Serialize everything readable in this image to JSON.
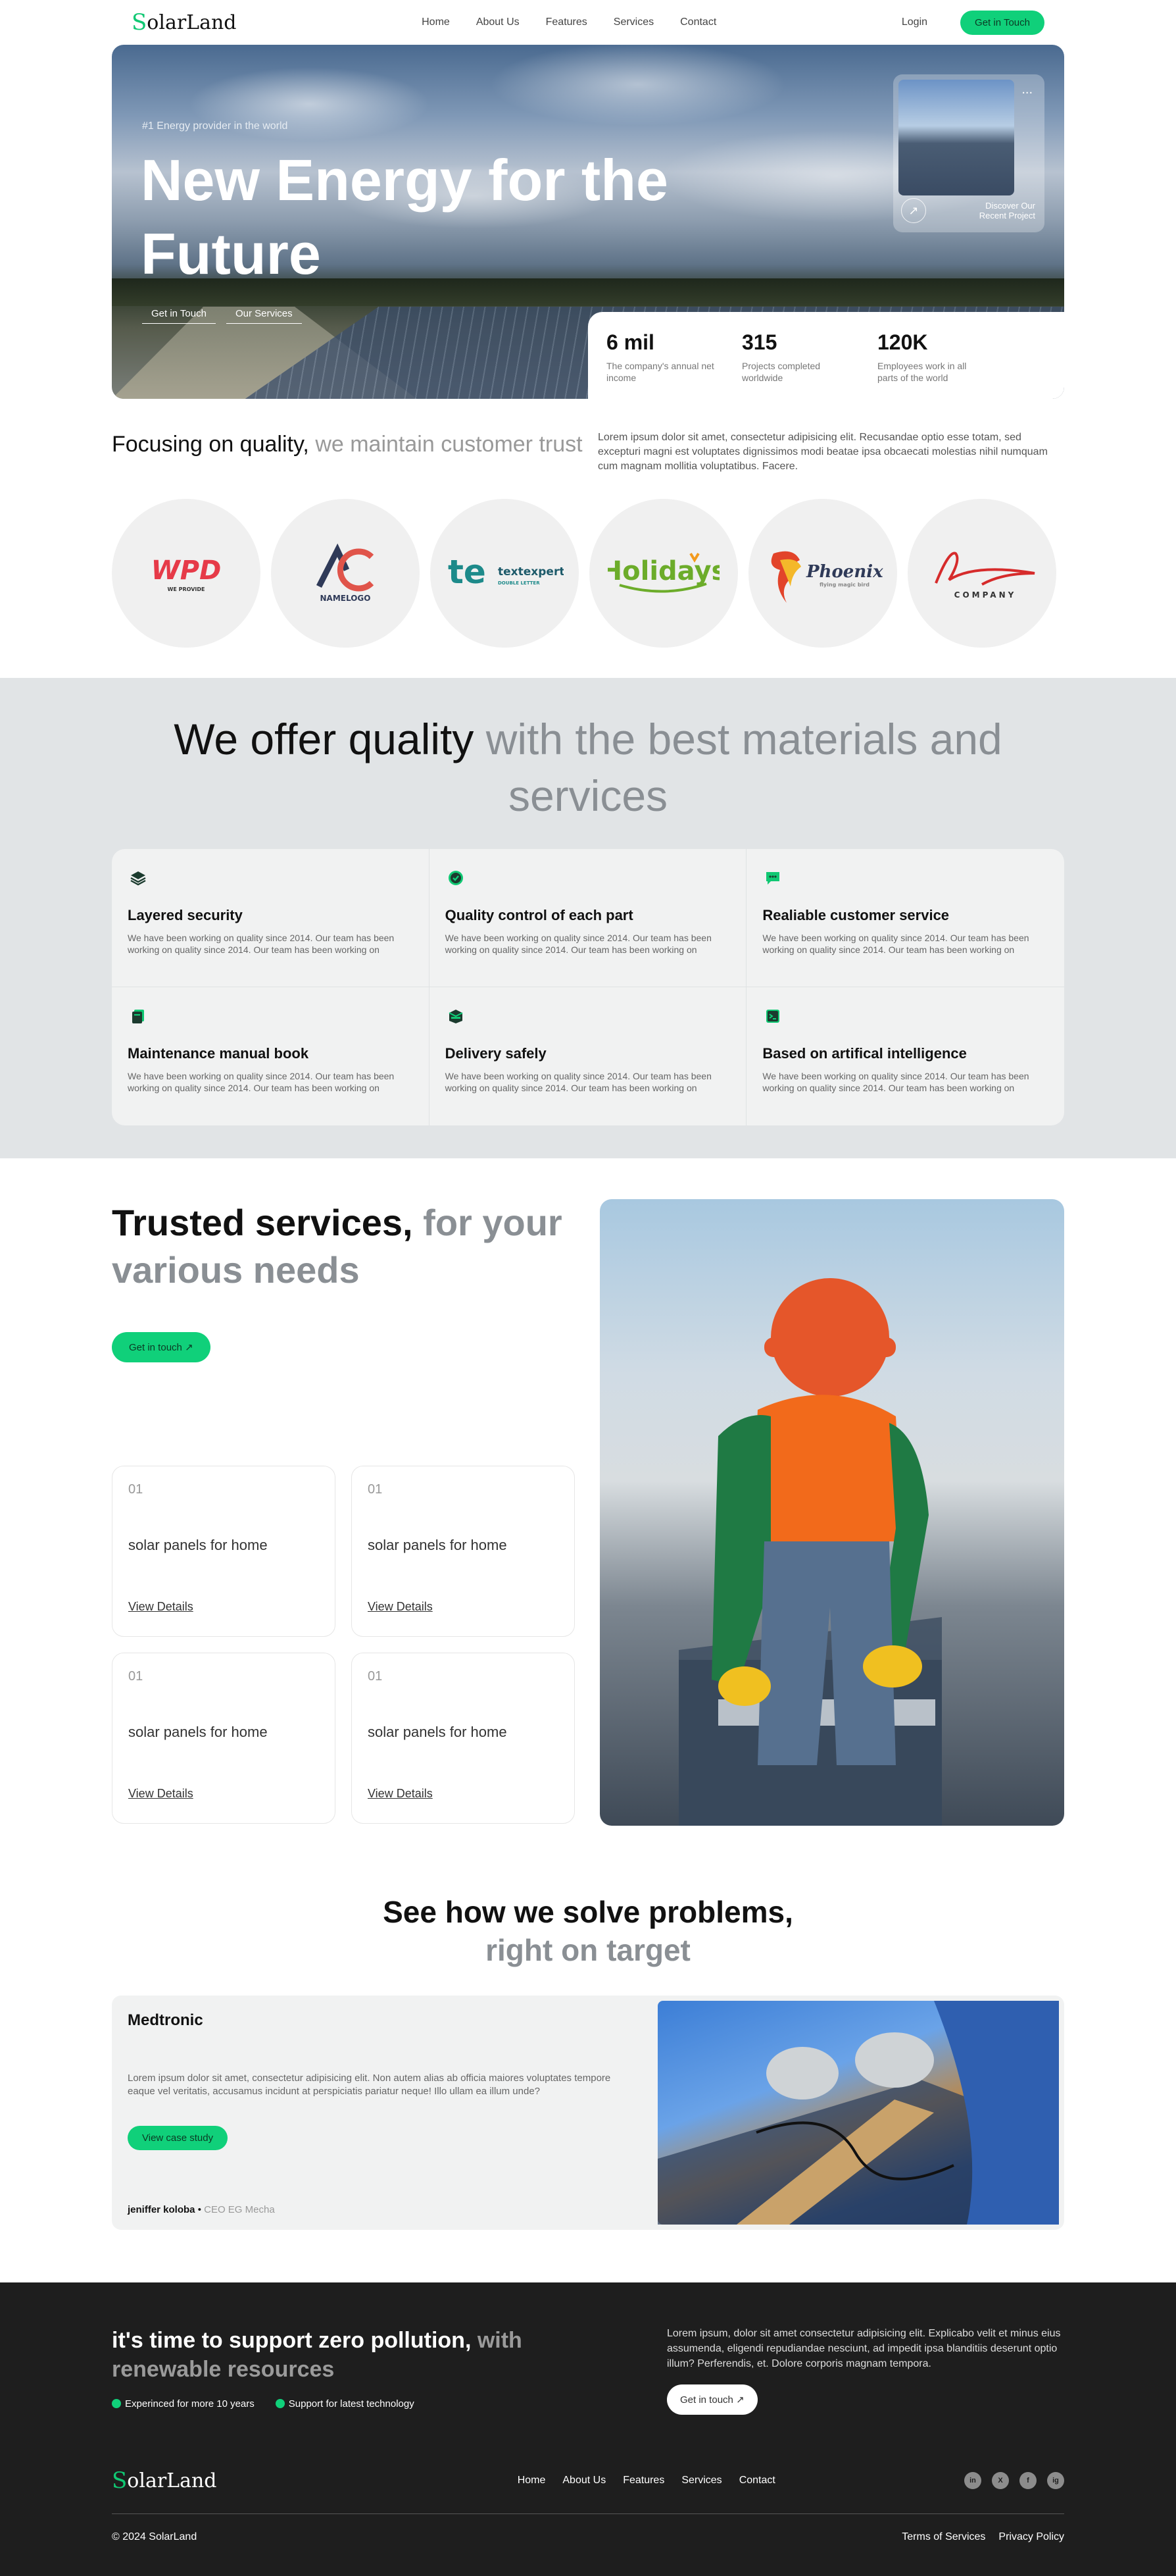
{
  "nav": {
    "logo_s": "S",
    "logo_rest": "olarLand",
    "links": [
      "Home",
      "About Us",
      "Features",
      "Services",
      "Contact"
    ],
    "login": "Login",
    "cta": "Get in Touch"
  },
  "hero": {
    "tag": "#1 Energy provider in the world",
    "title": "New Energy for the Future",
    "link1": "Get in Touch",
    "link2": "Our Services",
    "recent_dots": "...",
    "recent_label": "Discover Our Recent Project",
    "stats": [
      {
        "value": "6 mil",
        "label": "The company's annual net income"
      },
      {
        "value": "315",
        "label": "Projects completed worldwide"
      },
      {
        "value": "120K",
        "label": "Employees work in all parts of the world"
      }
    ]
  },
  "focus": {
    "title_dark": "Focusing on quality,",
    "title_grey": " we maintain customer trust",
    "text": "Lorem ipsum dolor sit amet, consectetur adipisicing elit. Recusandae optio esse totam, sed excepturi magni est voluptates dignissimos modi beatae ipsa obcaecati molestias nihil numquam cum magnam mollitia voluptatibus. Facere."
  },
  "logos": [
    {
      "name": "WPD",
      "sub": "WE PROVIDE"
    },
    {
      "name": "NAMELOGO",
      "mark": "AC"
    },
    {
      "name": "textexpert",
      "sub": "DOUBLE LETTER"
    },
    {
      "name": "Holidays"
    },
    {
      "name": "Phoenix",
      "sub": "flying magic bird"
    },
    {
      "name": "COMPANY"
    }
  ],
  "offer": {
    "title_dark": "We offer quality",
    "title_grey": " with the best materials and services",
    "items": [
      {
        "title": "Layered security",
        "text": "We have been working on quality since 2014. Our team has been working on quality since 2014. Our team has been working on"
      },
      {
        "title": "Quality control of each part",
        "text": "We have been working on quality since 2014. Our team has been working on quality since 2014. Our team has been working on"
      },
      {
        "title": "Realiable customer service",
        "text": "We have been working on quality since 2014. Our team has been working on quality since 2014. Our team has been working on"
      },
      {
        "title": "Maintenance manual book",
        "text": "We have been working on quality since 2014. Our team has been working on quality since 2014. Our team has been working on"
      },
      {
        "title": "Delivery safely",
        "text": "We have been working on quality since 2014. Our team has been working on quality since 2014. Our team has been working on"
      },
      {
        "title": "Based on artifical intelligence",
        "text": "We have been working on quality since 2014. Our team has been working on quality since 2014. Our team has been working on"
      }
    ]
  },
  "trusted": {
    "title_dark": "Trusted services,",
    "title_grey": " for your various needs",
    "cta": "Get in touch",
    "cards": [
      {
        "num": "01",
        "title": "solar panels for home",
        "link": "View Details"
      },
      {
        "num": "01",
        "title": "solar panels for home",
        "link": "View Details"
      },
      {
        "num": "01",
        "title": "solar panels for home",
        "link": "View Details"
      },
      {
        "num": "01",
        "title": "solar panels for home",
        "link": "View Details"
      }
    ]
  },
  "solve": {
    "title_dark": "See how we solve problems,",
    "title_grey": "right on target",
    "company": "Medtronic",
    "text": "Lorem ipsum dolor sit amet, consectetur adipisicing elit. Non autem alias ab officia maiores voluptates tempore eaque vel veritatis, accusamus incidunt at perspiciatis pariatur neque! Illo ullam ea illum unde?",
    "cta": "View case study",
    "author": "jeniffer koloba",
    "author_sep": " • ",
    "author_role": "CEO EG Mecha"
  },
  "footer": {
    "title_dark": "it's time to support zero pollution,",
    "title_grey": " with renewable resources",
    "check1": "Experinced for more 10 years",
    "check2": "Support for latest technology",
    "text": "Lorem ipsum, dolor sit amet consectetur adipisicing elit. Explicabo velit et minus eius assumenda, eligendi repudiandae nesciunt, ad impedit ipsa blanditiis deserunt optio illum? Perferendis, et. Dolore corporis magnam tempora.",
    "cta": "Get in touch",
    "logo_s": "S",
    "logo_rest": "olarLand",
    "links": [
      "Home",
      "About Us",
      "Features",
      "Services",
      "Contact"
    ],
    "social": [
      "in",
      "X",
      "f",
      "ig"
    ],
    "copyright": "© 2024 SolarLand",
    "terms": "Terms of Services",
    "privacy": "Privacy Policy"
  },
  "colors": {
    "accent": "#10d07a",
    "dark": "#1e1e1e",
    "light_bg": "#e1e4e6"
  }
}
